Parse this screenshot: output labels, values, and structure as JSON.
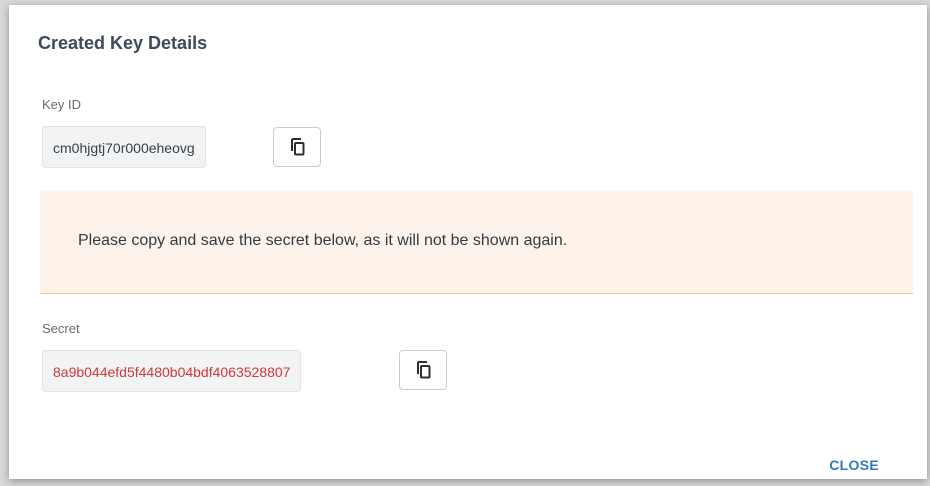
{
  "dialog": {
    "title": "Created Key Details",
    "key_id": {
      "label": "Key ID",
      "value": "cm0hjgtj70r000eheovg",
      "copy_icon": "copy-icon"
    },
    "warning": {
      "text": "Please copy and save the secret below, as it will not be shown again."
    },
    "secret": {
      "label": "Secret",
      "value": "8a9b044efd5f4480b04bdf4063528807",
      "copy_icon": "copy-icon",
      "value_color": "#d0393c"
    },
    "close_label": "CLOSE"
  },
  "colors": {
    "accent": "#2f7bbf",
    "warning_bg": "#fdf3ea",
    "warning_border": "#efc896"
  }
}
